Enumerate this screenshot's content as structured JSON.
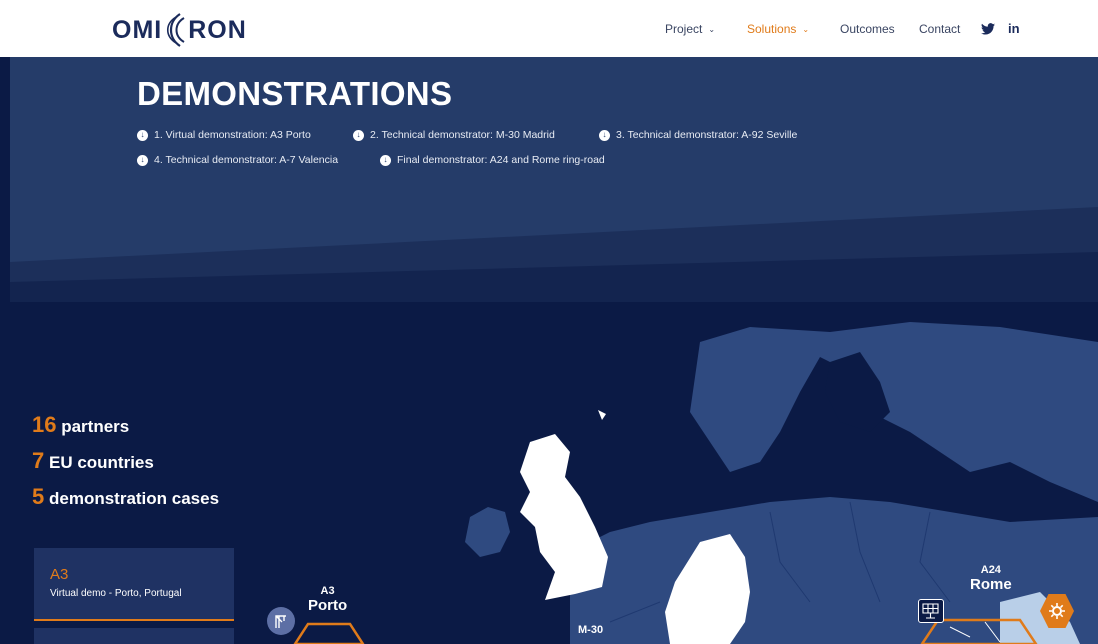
{
  "brand": {
    "logo_left": "OMI",
    "logo_right": "RON"
  },
  "nav": {
    "items": [
      {
        "label": "Project",
        "has_dropdown": true,
        "active": false
      },
      {
        "label": "Solutions",
        "has_dropdown": true,
        "active": true
      },
      {
        "label": "Outcomes",
        "has_dropdown": false,
        "active": false
      },
      {
        "label": "Contact",
        "has_dropdown": false,
        "active": false
      }
    ],
    "social": [
      {
        "icon": "twitter-icon"
      },
      {
        "icon": "linkedin-icon",
        "text": "in"
      }
    ]
  },
  "hero": {
    "title": "DEMONSTRATIONS",
    "links": [
      "1. Virtual demonstration: A3 Porto",
      "2. Technical demonstrator: M-30 Madrid",
      "3. Technical demonstrator: A-92 Seville",
      "4. Technical demonstrator: A-7 Valencia",
      "Final demonstrator: A24 and Rome ring-road"
    ]
  },
  "stats": [
    {
      "number": "16",
      "label": "partners"
    },
    {
      "number": "7",
      "label": "EU countries"
    },
    {
      "number": "5",
      "label": "demonstration cases"
    }
  ],
  "cards": [
    {
      "code": "A3",
      "description": "Virtual demo - Porto, Portugal"
    }
  ],
  "map_labels": [
    {
      "code": "A3",
      "city": "Porto"
    },
    {
      "code": "M-30",
      "city": ""
    },
    {
      "code": "A24",
      "city": "Rome"
    }
  ],
  "colors": {
    "accent": "#e07b1a",
    "navy": "#0b1a45",
    "hero": "#253c69",
    "land": "#2f4a80",
    "highlight_land": "#ffffff"
  }
}
